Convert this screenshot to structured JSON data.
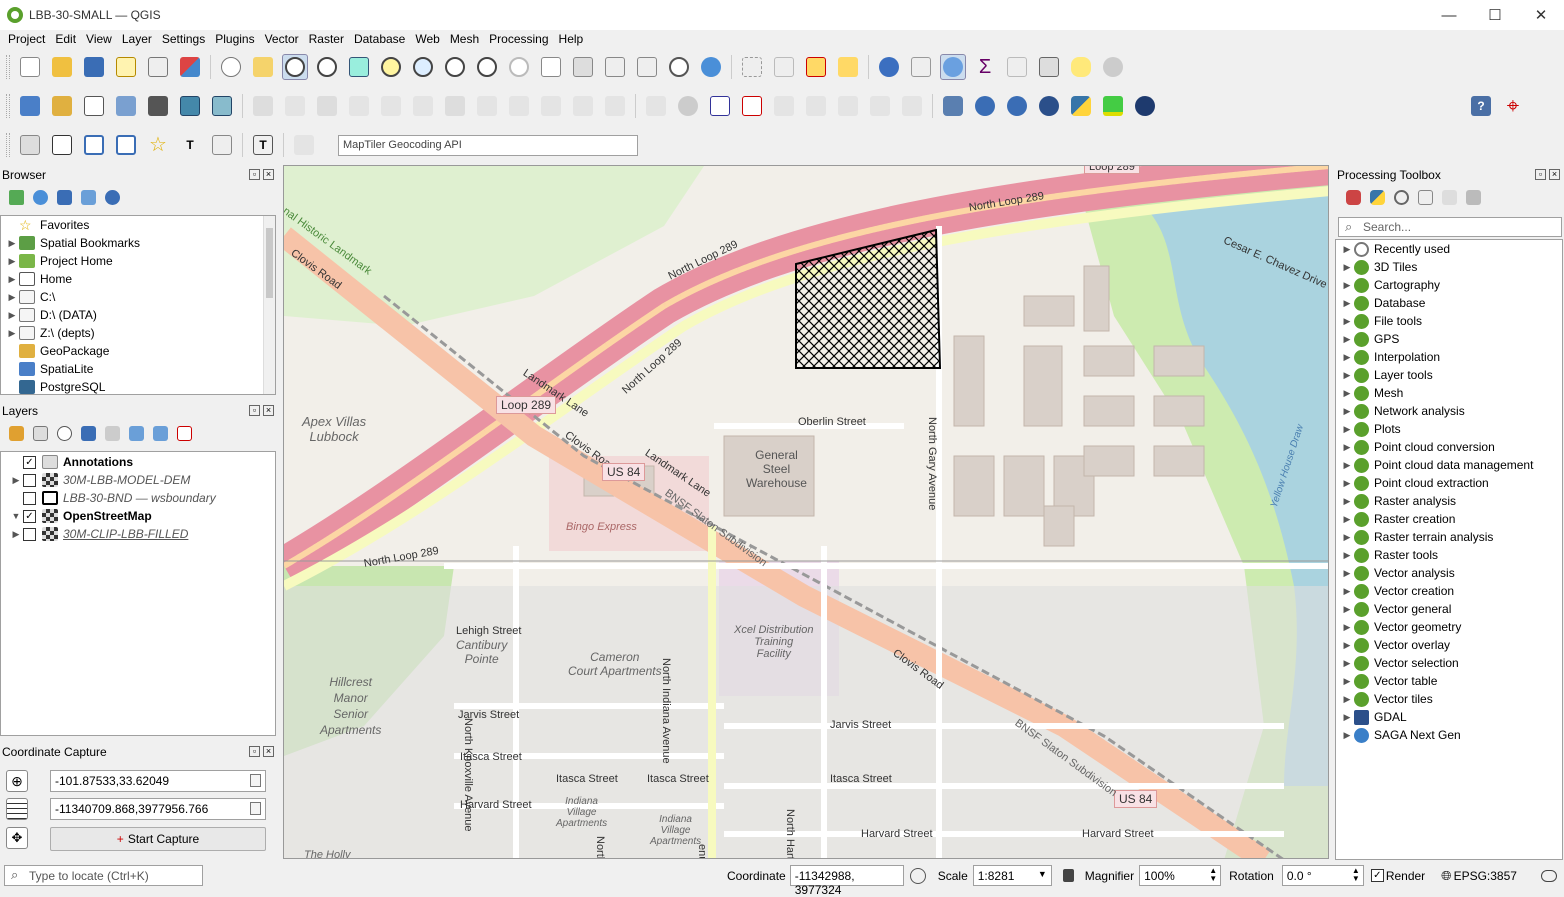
{
  "window": {
    "title": "LBB-30-SMALL — QGIS",
    "minimize": "—",
    "maximize": "☐",
    "close": "✕"
  },
  "menu": [
    "Project",
    "Edit",
    "View",
    "Layer",
    "Settings",
    "Plugins",
    "Vector",
    "Raster",
    "Database",
    "Web",
    "Mesh",
    "Processing",
    "Help"
  ],
  "geocoder": {
    "placeholder": "MapTiler Geocoding API"
  },
  "browser": {
    "title": "Browser",
    "items": [
      {
        "label": "Favorites",
        "icon": "star-icon"
      },
      {
        "label": "Spatial Bookmarks",
        "icon": "bookmark-icon"
      },
      {
        "label": "Project Home",
        "icon": "project-home-icon"
      },
      {
        "label": "Home",
        "icon": "home-folder-icon"
      },
      {
        "label": "C:\\",
        "icon": "drive-icon"
      },
      {
        "label": "D:\\ (DATA)",
        "icon": "drive-icon"
      },
      {
        "label": "Z:\\ (depts)",
        "icon": "drive-icon"
      },
      {
        "label": "GeoPackage",
        "icon": "geopackage-icon"
      },
      {
        "label": "SpatiaLite",
        "icon": "spatialite-icon"
      },
      {
        "label": "PostgreSQL",
        "icon": "postgresql-icon"
      }
    ]
  },
  "layers": {
    "title": "Layers",
    "items": [
      {
        "label": "Annotations",
        "checked": true,
        "style": "bold"
      },
      {
        "label": "30M-LBB-MODEL-DEM",
        "checked": false,
        "style": "italic"
      },
      {
        "label": "LBB-30-BND — wsboundary",
        "checked": false,
        "style": "italic"
      },
      {
        "label": "OpenStreetMap",
        "checked": true,
        "style": "bold"
      },
      {
        "label": "30M-CLIP-LBB-FILLED",
        "checked": false,
        "style": "italic-underline"
      }
    ]
  },
  "coordinate_capture": {
    "title": "Coordinate Capture",
    "wgs84": "-101.87533,33.62049",
    "projected": "-11340709.868,3977956.766",
    "start_button": "Start Capture"
  },
  "toolbox": {
    "title": "Processing Toolbox",
    "search_placeholder": "Search...",
    "items": [
      "Recently used",
      "3D Tiles",
      "Cartography",
      "Database",
      "File tools",
      "GPS",
      "Interpolation",
      "Layer tools",
      "Mesh",
      "Network analysis",
      "Plots",
      "Point cloud conversion",
      "Point cloud data management",
      "Point cloud extraction",
      "Raster analysis",
      "Raster creation",
      "Raster terrain analysis",
      "Raster tools",
      "Vector analysis",
      "Vector creation",
      "Vector general",
      "Vector geometry",
      "Vector overlay",
      "Vector selection",
      "Vector table",
      "Vector tiles",
      "GDAL",
      "SAGA Next Gen"
    ]
  },
  "map_labels": {
    "loop289_top": "Loop 289",
    "north_loop_289_a": "North Loop 289",
    "north_loop_289_b": "North Loop 289",
    "north_loop_289_c": "North Loop 289",
    "north_loop_289_d": "North Loop 289",
    "cesar_chavez": "Cesar E. Chavez Drive",
    "historic_landmark": "nal Historic Landmark",
    "clovis_road_a": "Clovis Road",
    "clovis_road_b": "Clovis Road",
    "clovis_road_c": "Clovis Road",
    "landmark_lane_a": "Landmark Lane",
    "landmark_lane_b": "Landmark Lane",
    "loop289_shield": "Loop 289",
    "us84_a": "US 84",
    "us84_b": "US 84",
    "apex_villas": "Apex Villas\nLubbock",
    "oberlin": "Oberlin Street",
    "general_steel": "General\nSteel\nWarehouse",
    "north_gary": "North Gary Avenue",
    "bnsf_a": "BNSF Slaton Subdivision",
    "bnsf_b": "BNSF Slaton Subdivision",
    "bingo": "Bingo Express",
    "lehigh": "Lehigh Street",
    "cantibury": "Cantibury\nPointe",
    "cameron": "Cameron\nCourt Apartments",
    "hillcrest": "Hillcrest\nManor\nSenior\nApartments",
    "north_knoxville": "North Knoxville Avenue",
    "north_indiana": "North Indiana Avenue",
    "xcel": "Xcel Distribution\nTraining\nFacility",
    "jarvis_a": "Jarvis Street",
    "jarvis_b": "Jarvis Street",
    "itasca_a": "Itasca Street",
    "itasca_b": "Itasca Street",
    "itasca_c": "Itasca Street",
    "itasca_d": "Itasca Street",
    "harvard_a": "Harvard Street",
    "harvard_b": "Harvard Street",
    "harvard_c": "Harvard Street",
    "indiana_village_a": "Indiana\nVillage\nApartments",
    "indiana_village_b": "Indiana\nVillage\nApartments",
    "north_ithaca": "North Ithaca Ave",
    "north_hartford": "North Hartford Avenue",
    "yellow_house": "Yellow House Draw",
    "the_holly": "The Holly",
    "avenue_frag": "enue"
  },
  "statusbar": {
    "locate_placeholder": "Type to locate (Ctrl+K)",
    "coordinate_label": "Coordinate",
    "coordinate_value": "-11342988, 3977324",
    "scale_label": "Scale",
    "scale_value": "1:8281",
    "magnifier_label": "Magnifier",
    "magnifier_value": "100%",
    "rotation_label": "Rotation",
    "rotation_value": "0.0 °",
    "render_label": "Render",
    "render_checked": true,
    "crs": "EPSG:3857"
  }
}
